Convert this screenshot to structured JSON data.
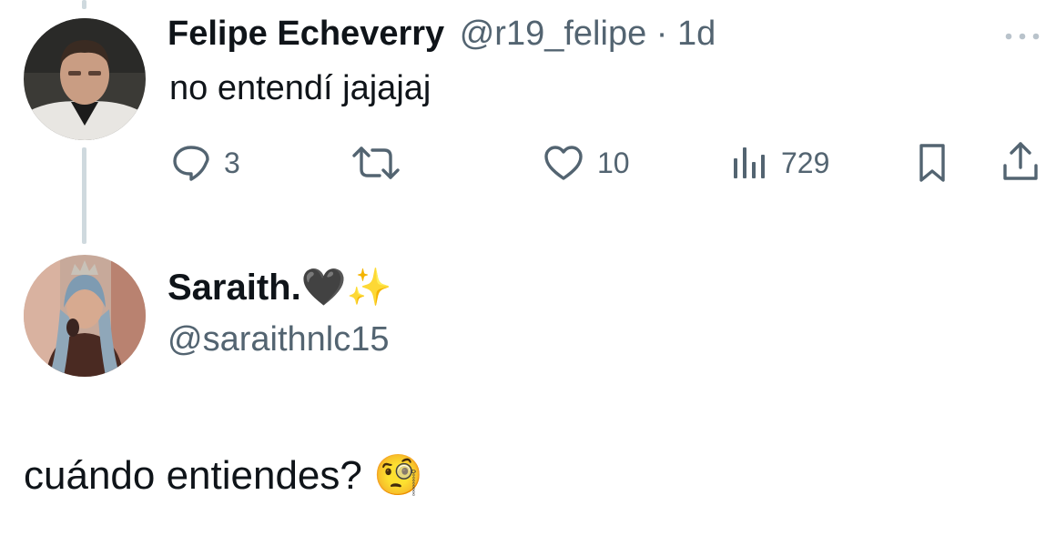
{
  "reply": {
    "author_name": "Felipe Echeverry",
    "handle": "@r19_felipe",
    "separator": "·",
    "time": "1d",
    "more_label": "•••",
    "text": "no entendí jajajaj",
    "actions": {
      "replies": "3",
      "likes": "10",
      "views": "729"
    }
  },
  "main": {
    "author_name": "Saraith.",
    "name_emojis": "🖤✨",
    "handle": "@saraithnlc15",
    "text": "cuándo entiendes?",
    "text_emoji": "🧐"
  },
  "colors": {
    "text": "#0f1419",
    "secondary": "#536471",
    "thread_line": "#cfd9de"
  }
}
